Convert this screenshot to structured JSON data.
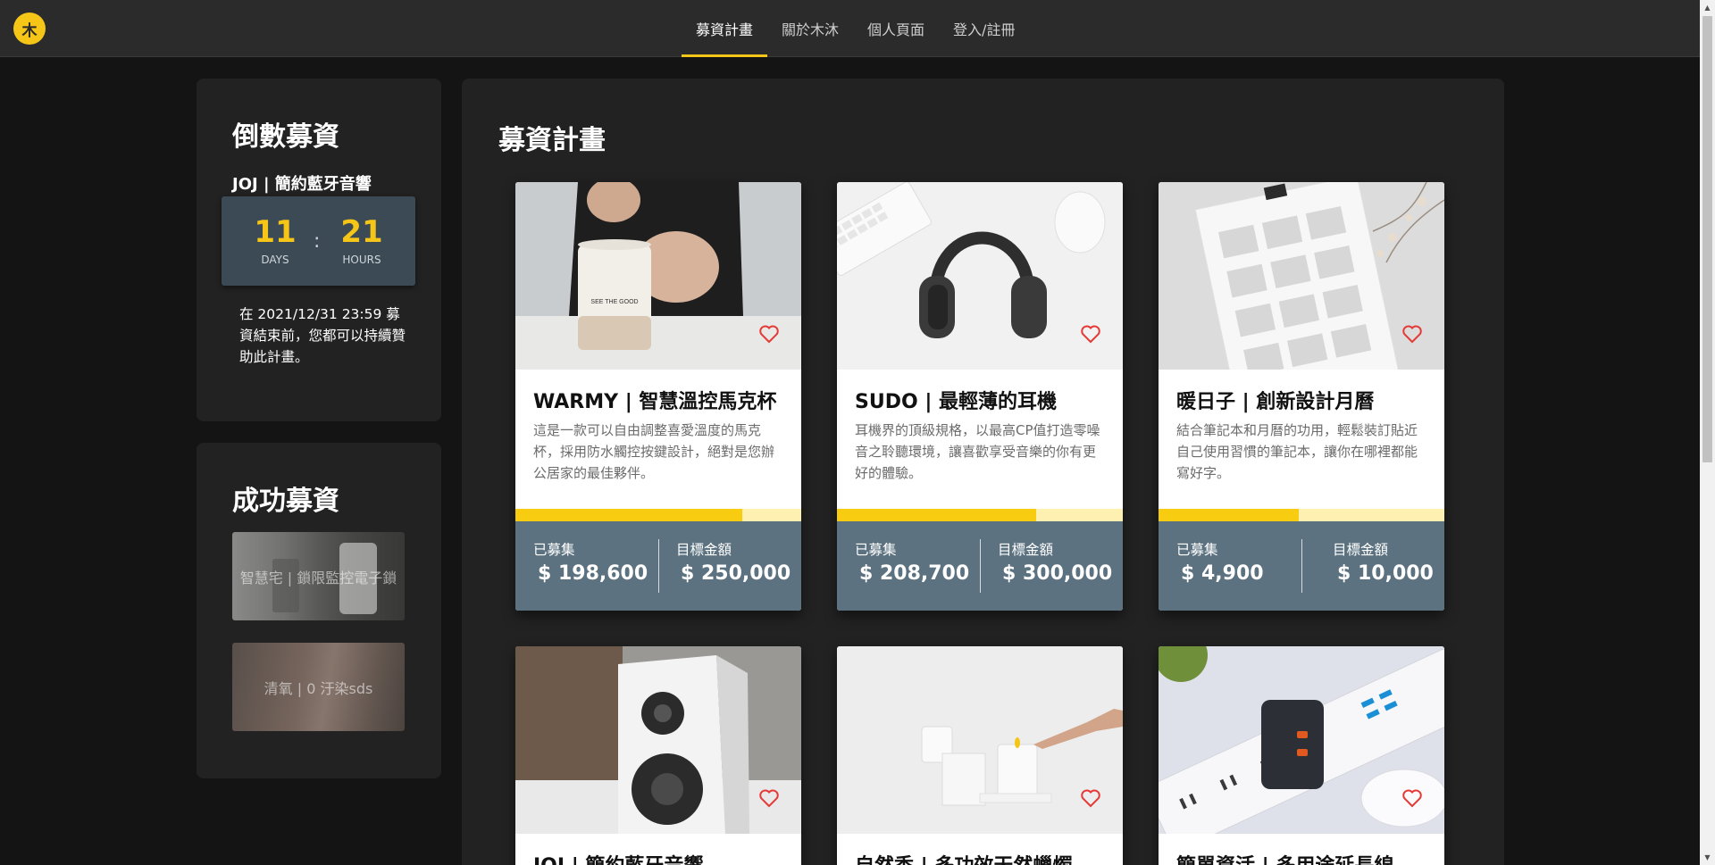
{
  "brand": {
    "logo_char": "木"
  },
  "nav": {
    "items": [
      {
        "label": "募資計畫",
        "active": true
      },
      {
        "label": "關於木沐",
        "active": false
      },
      {
        "label": "個人頁面",
        "active": false
      },
      {
        "label": "登入/註冊",
        "active": false
      }
    ]
  },
  "countdown": {
    "title": "倒數募資",
    "project": "JOJ | 簡約藍牙音響",
    "days": "11",
    "days_label": "DAYS",
    "separator": ":",
    "hours": "21",
    "hours_label": "HOURS",
    "note": "在 2021/12/31 23:59 募資結束前，您都可以持續贊助此計畫。"
  },
  "success": {
    "title": "成功募資",
    "items": [
      {
        "label": "智慧宅 | 鎖限監控電子鎖"
      },
      {
        "label": "清氧 | 0 汙染sds"
      }
    ]
  },
  "main": {
    "title": "募資計畫",
    "raised_label": "已募集",
    "goal_label": "目標金額",
    "projects": [
      {
        "title": "WARMY | 智慧溫控馬克杯",
        "description": "這是一款可以自由調整喜愛溫度的馬克杯，採用防水觸控按鍵設計，絕對是您辦公居家的最佳夥伴。",
        "raised": "$ 198,600",
        "goal": "$ 250,000",
        "progress": 0.7944,
        "mug_text": "SEE THE GOOD"
      },
      {
        "title": "SUDO | 最輕薄的耳機",
        "description": "耳機界的頂級規格，以最高CP值打造零噪音之聆聽環境，讓喜歡享受音樂的你有更好的體驗。",
        "raised": "$ 208,700",
        "goal": "$ 300,000",
        "progress": 0.6957
      },
      {
        "title": "暖日子 | 創新設計月曆",
        "description": "結合筆記本和月曆的功用，輕鬆裝訂貼近自己使用習慣的筆記本，讓你在哪裡都能寫好字。",
        "raised": "$ 4,900",
        "goal": "$ 10,000",
        "progress": 0.49
      },
      {
        "title": "JOJ | 簡約藍牙音響"
      },
      {
        "title": "自然香 | 多功效天然蠟燭"
      },
      {
        "title": "簡單資活 | 多用途延長線"
      }
    ]
  },
  "colors": {
    "accent": "#f5c518",
    "panel": "#222222",
    "background": "#141414",
    "stats_bar": "#5c7280",
    "progress_fill": "#f8cc10",
    "progress_track": "#fdf0b0",
    "heart": "#e53935"
  }
}
